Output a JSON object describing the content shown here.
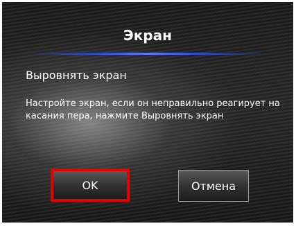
{
  "dialog": {
    "title": "Экран",
    "subtitle": "Выровнять экран",
    "description": "Настройте экран, если он неправильно реагирует на касания пера, нажмите Выровнять экран",
    "ok_label": "OK",
    "cancel_label": "Отмена"
  },
  "colors": {
    "accent_line": "#2a4fd8",
    "highlight_border": "#e50000",
    "text": "#ffffff"
  }
}
